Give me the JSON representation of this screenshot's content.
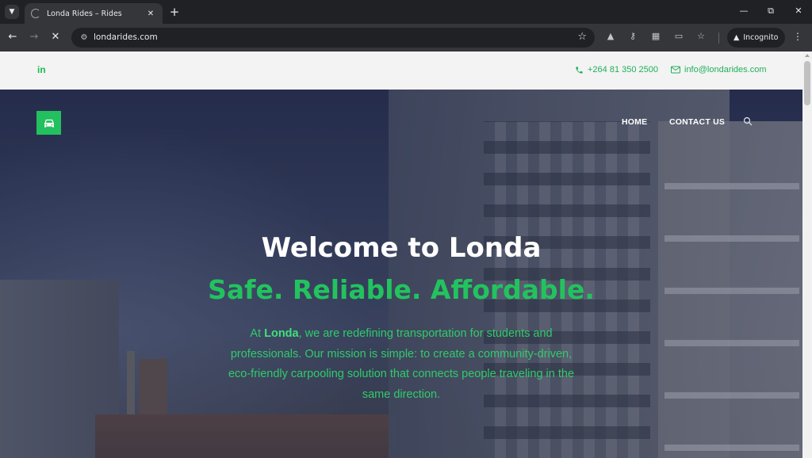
{
  "browser": {
    "tab_title": "Londa Rides – Rides",
    "url": "londarides.com",
    "incognito_label": "Incognito",
    "icons": {
      "tab_list": "chevron-down-icon",
      "new_tab": "plus-icon",
      "minimize": "minimize-icon",
      "restore": "restore-icon",
      "close": "close-icon",
      "back": "arrow-left-icon",
      "forward": "arrow-right-icon",
      "stop": "close-icon",
      "site_info": "tune-icon",
      "bookmark": "star-icon",
      "menu": "more-vert-icon"
    }
  },
  "topbar": {
    "social": "in",
    "phone": "+264 81 350 2500",
    "email": "info@londarides.com"
  },
  "nav": {
    "items": [
      {
        "label": "HOME"
      },
      {
        "label": "CONTACT US"
      }
    ]
  },
  "hero": {
    "title": "Welcome to Londa",
    "tagline": "Safe. Reliable. Affordable.",
    "desc_prefix": "At ",
    "desc_brand": "Londa",
    "desc_rest": ", we are redefining transportation for students and professionals. Our mission is simple: to create a community-driven, eco-friendly carpooling solution that connects people traveling in the same direction."
  },
  "colors": {
    "accent": "#22c05e",
    "chrome_dark": "#202124",
    "chrome_toolbar": "#35363a",
    "topbar_bg": "#f3f3f3"
  }
}
